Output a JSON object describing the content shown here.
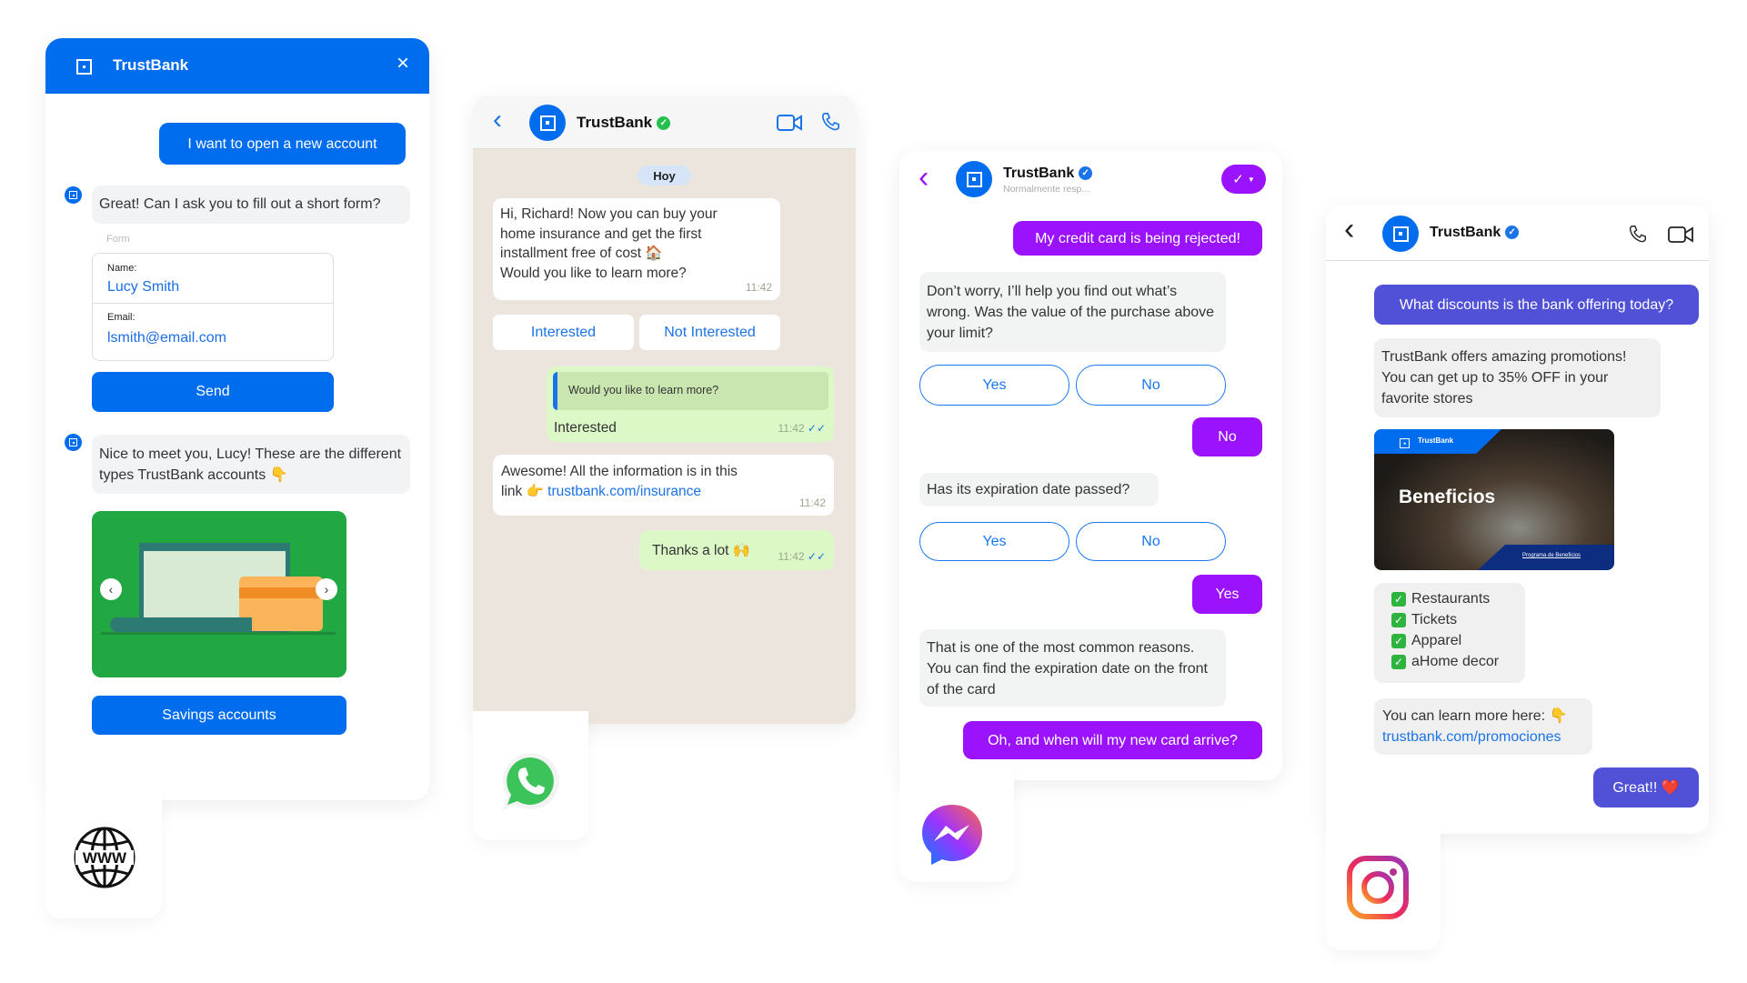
{
  "web": {
    "header_title": "TrustBank",
    "user_message": "I want to open a new account",
    "bot_message_1": "Great! Can I ask you to fill out a short form?",
    "form_label": "Form",
    "form": {
      "name_label": "Name:",
      "name_value": "Lucy Smith",
      "email_label": "Email:",
      "email_value": "lsmith@email.com"
    },
    "send_label": "Send",
    "bot_message_2": "Nice to meet you, Lucy! These are the different types TrustBank accounts 👇",
    "carousel_button": "Savings accounts",
    "channel_icon": "www-globe-icon",
    "channel_icon_text": "WWW",
    "accent": "#006cee"
  },
  "whatsapp": {
    "title": "TrustBank",
    "date_pill": "Hoy",
    "msg1": [
      "Hi, Richard! Now you can buy your",
      "home insurance and get the first",
      "installment free of cost 🏠",
      "Would you like to learn more?"
    ],
    "msg1_time": "11:42",
    "buttons": [
      "Interested",
      "Not Interested"
    ],
    "reply_quote": "Would you like to learn more?",
    "reply_text": "Interested",
    "reply_time": "11:42",
    "msg3_line1": "Awesome! All the information is in this",
    "msg3_prefix": "link 👉 ",
    "msg3_link": "trustbank.com/insurance",
    "msg3_time": "11:42",
    "thanks": "Thanks a lot 🙌",
    "thanks_time": "11:42",
    "bg": "#ece5dd",
    "out_bubble": "#dcf8c6"
  },
  "messenger": {
    "title": "TrustBank",
    "subtitle": "Normalmente resp...",
    "user_msg1": "My credit card is being rejected!",
    "bot_msg1": "Don’t worry, I’ll help you find out what’s wrong. Was the value of the purchase above your limit?",
    "quick1": [
      "Yes",
      "No"
    ],
    "user_msg2": "No",
    "bot_msg2": "Has its expiration date passed?",
    "quick2": [
      "Yes",
      "No"
    ],
    "user_msg3": "Yes",
    "bot_msg3": "That is one of the most common reasons. You can find the expiration date on the front of the card",
    "user_msg4": "Oh, and when will my new card arrive?",
    "accent": "#9b13fc"
  },
  "instagram": {
    "title": "TrustBank",
    "user_msg1": "What discounts is the bank offering today?",
    "bot_msg1": "TrustBank offers amazing promotions! You can get up to 35% OFF in your favorite stores",
    "card": {
      "brand": "TrustBank",
      "title": "Beneficios",
      "footer": "Programa de Beneficios"
    },
    "list": [
      "Restaurants",
      "Tickets",
      "Apparel",
      "aHome decor"
    ],
    "learn_text": "You can learn more here: 👇",
    "learn_link": "trustbank.com/promociones",
    "user_msg2": "Great!! ❤️",
    "accent": "#5151d8"
  }
}
